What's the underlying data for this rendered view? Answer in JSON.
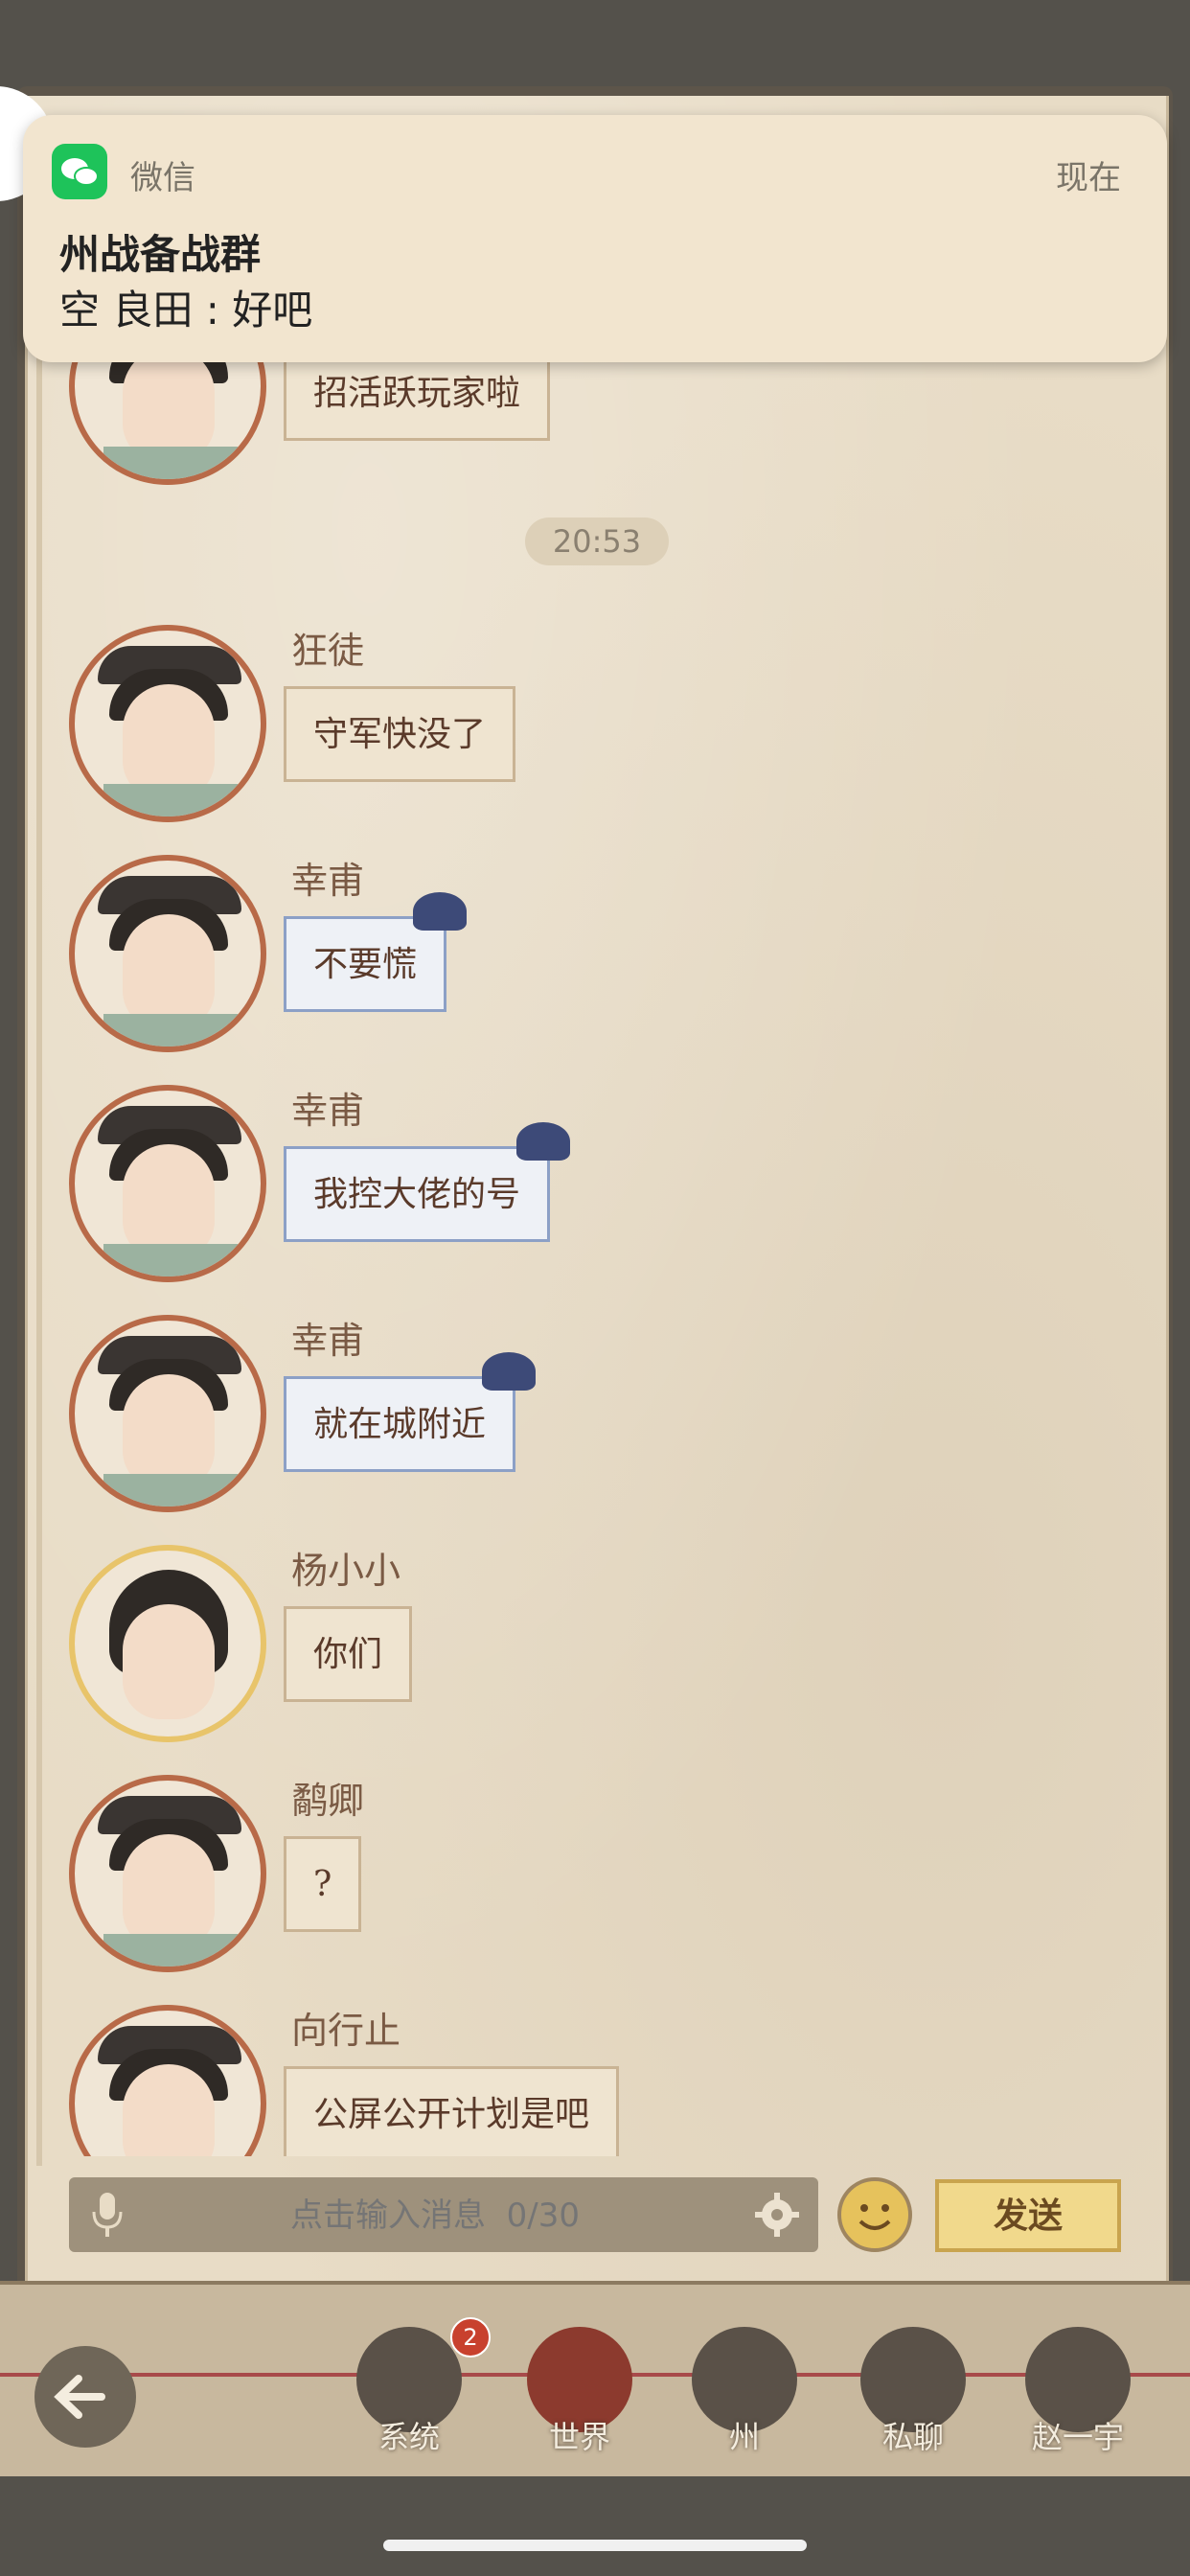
{
  "notification": {
    "app_name": "微信",
    "time": "现在",
    "title": "州战备战群",
    "body": "空 良田 : 好吧"
  },
  "chat": {
    "partial_message": "招活跃玩家啦",
    "timestamp": "20:53",
    "messages": [
      {
        "sender": "狂徒",
        "text": "守军快没了",
        "style": "plain"
      },
      {
        "sender": "幸甫",
        "text": "不要慌",
        "style": "blue"
      },
      {
        "sender": "幸甫",
        "text": "我控大佬的号",
        "style": "blue"
      },
      {
        "sender": "幸甫",
        "text": "就在城附近",
        "style": "blue"
      },
      {
        "sender": "杨小小",
        "text": "你们",
        "style": "plain"
      },
      {
        "sender": "鹬卿",
        "text": "?",
        "style": "plain"
      },
      {
        "sender": "向行止",
        "text": "公屏公开计划是吧",
        "style": "plain"
      }
    ]
  },
  "input": {
    "placeholder": "点击输入消息  0/30",
    "send_label": "发送"
  },
  "tabs": [
    {
      "label": "系统",
      "badge": "2"
    },
    {
      "label": "世界"
    },
    {
      "label": "州"
    },
    {
      "label": "私聊"
    },
    {
      "label": "赵一宇"
    }
  ],
  "colors": {
    "paper": "#e8dcc6",
    "bubble_blue_border": "#8ca0c6",
    "badge": "#c8412e",
    "wechat_green": "#1ec35a"
  }
}
